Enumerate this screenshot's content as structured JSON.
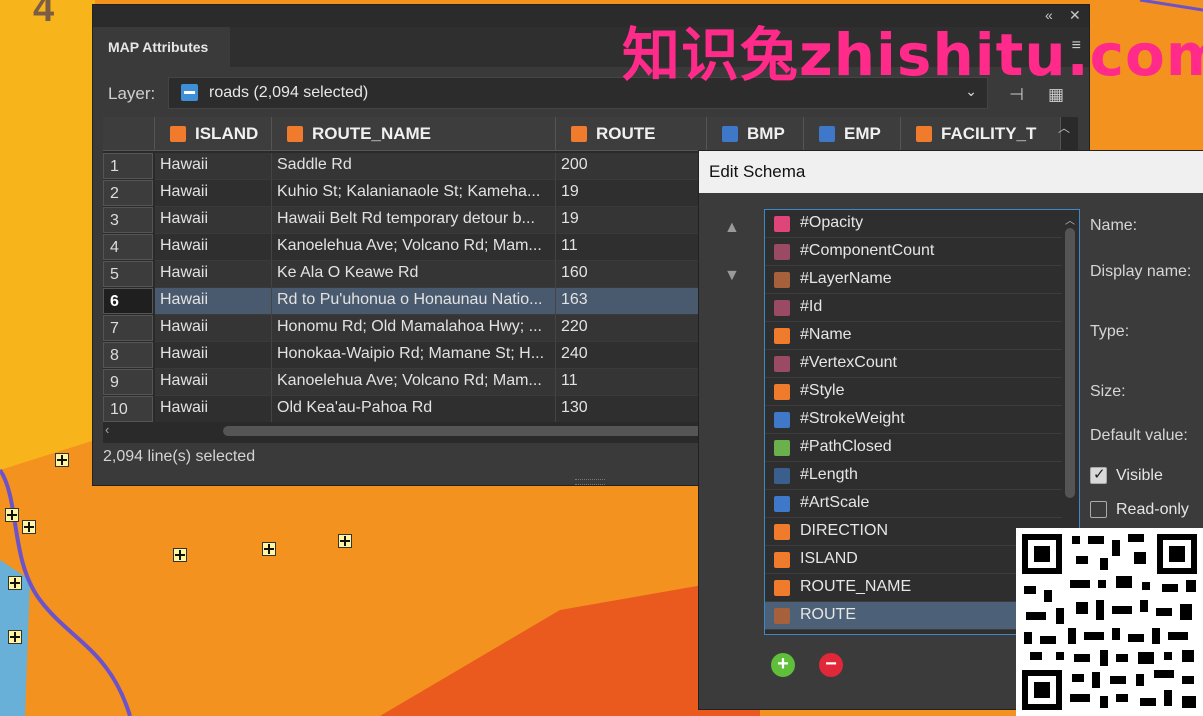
{
  "map": {
    "label": "4",
    "colors": {
      "yellow": "#f8b51b",
      "orange": "#f3921f",
      "red": "#ea5a1e",
      "road": "#6c53c9"
    }
  },
  "watermark": "知识兔zhishitu.com",
  "panel": {
    "collapse_icon": "double-chevron-left-icon",
    "close_icon": "close-icon",
    "tab_label": "MAP Attributes",
    "layer_label": "Layer:",
    "layer_value": "roads (2,094 selected)",
    "columns": [
      {
        "label": "ISLAND",
        "type": "string"
      },
      {
        "label": "ROUTE_NAME",
        "type": "string"
      },
      {
        "label": "ROUTE",
        "type": "string"
      },
      {
        "label": "BMP",
        "type": "number"
      },
      {
        "label": "EMP",
        "type": "number"
      },
      {
        "label": "FACILITY_T",
        "type": "string"
      }
    ],
    "rows": [
      {
        "num": "1",
        "island": "Hawaii",
        "route_name": "Saddle Rd",
        "route": "200"
      },
      {
        "num": "2",
        "island": "Hawaii",
        "route_name": "Kuhio St; Kalanianaole St; Kameha...",
        "route": "19"
      },
      {
        "num": "3",
        "island": "Hawaii",
        "route_name": "Hawaii Belt Rd temporary detour b...",
        "route": "19"
      },
      {
        "num": "4",
        "island": "Hawaii",
        "route_name": "Kanoelehua Ave; Volcano Rd; Mam...",
        "route": "11"
      },
      {
        "num": "5",
        "island": "Hawaii",
        "route_name": "Ke Ala O Keawe Rd",
        "route": "160"
      },
      {
        "num": "6",
        "island": "Hawaii",
        "route_name": "Rd to Pu'uhonua o Honaunau Natio...",
        "route": "163"
      },
      {
        "num": "7",
        "island": "Hawaii",
        "route_name": "Honomu Rd; Old Mamalahoa Hwy; ...",
        "route": "220"
      },
      {
        "num": "8",
        "island": "Hawaii",
        "route_name": "Honokaa-Waipio Rd; Mamane St; H...",
        "route": "240"
      },
      {
        "num": "9",
        "island": "Hawaii",
        "route_name": "Kanoelehua Ave; Volcano Rd; Mam...",
        "route": "11"
      },
      {
        "num": "10",
        "island": "Hawaii",
        "route_name": "Old Kea'au-Pahoa Rd",
        "route": "130"
      }
    ],
    "selected_row": "6",
    "status": "2,094 line(s) selected"
  },
  "schema": {
    "title": "Edit Schema",
    "fields": [
      {
        "label": "#Opacity",
        "icon": "pink"
      },
      {
        "label": "#ComponentCount",
        "icon": "pinkd"
      },
      {
        "label": "#LayerName",
        "icon": "orangeb"
      },
      {
        "label": "#Id",
        "icon": "pinkd"
      },
      {
        "label": "#Name",
        "icon": "orange"
      },
      {
        "label": "#VertexCount",
        "icon": "pinkd"
      },
      {
        "label": "#Style",
        "icon": "orange"
      },
      {
        "label": "#StrokeWeight",
        "icon": "blue"
      },
      {
        "label": "#PathClosed",
        "icon": "green"
      },
      {
        "label": "#Length",
        "icon": "blued"
      },
      {
        "label": "#ArtScale",
        "icon": "blue"
      },
      {
        "label": "DIRECTION",
        "icon": "orange"
      },
      {
        "label": "ISLAND",
        "icon": "orange"
      },
      {
        "label": "ROUTE_NAME",
        "icon": "orange"
      },
      {
        "label": "ROUTE",
        "icon": "orangeb"
      }
    ],
    "selected_field": "ROUTE",
    "props": {
      "name": "Name:",
      "display_name": "Display name:",
      "type": "Type:",
      "size": "Size:",
      "default_value": "Default value:",
      "visible": "Visible",
      "read_only": "Read-only"
    },
    "visible_checked": true,
    "read_only_checked": false
  }
}
